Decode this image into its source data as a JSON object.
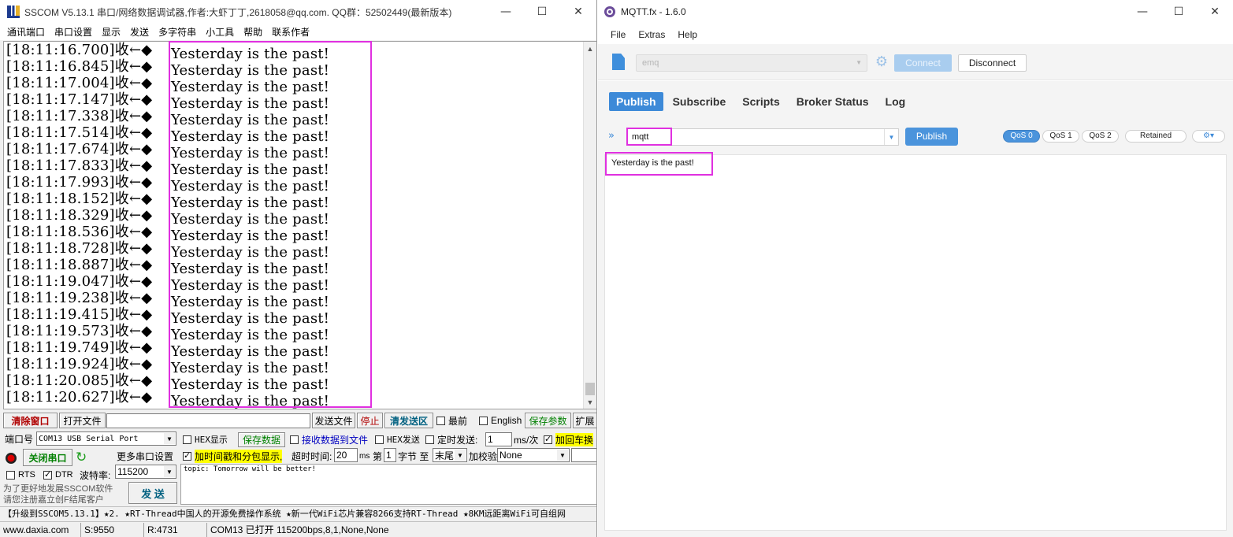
{
  "sscom": {
    "title": "SSCOM V5.13.1 串口/网络数据调试器,作者:大虾丁丁,2618058@qq.com. QQ群：52502449(最新版本)",
    "window_buttons": {
      "minimize": "—",
      "maximize": "☐",
      "close": "✕"
    },
    "menu": [
      "通讯端口",
      "串口设置",
      "显示",
      "发送",
      "多字符串",
      "小工具",
      "帮助",
      "联系作者"
    ],
    "receive_lines": [
      {
        "ts": "[18:11:16.700]收←◆",
        "msg": "Yesterday is the past!"
      },
      {
        "ts": "[18:11:16.845]收←◆",
        "msg": "Yesterday is the past!"
      },
      {
        "ts": "[18:11:17.004]收←◆",
        "msg": "Yesterday is the past!"
      },
      {
        "ts": "[18:11:17.147]收←◆",
        "msg": "Yesterday is the past!"
      },
      {
        "ts": "[18:11:17.338]收←◆",
        "msg": "Yesterday is the past!"
      },
      {
        "ts": "[18:11:17.514]收←◆",
        "msg": "Yesterday is the past!"
      },
      {
        "ts": "[18:11:17.674]收←◆",
        "msg": "Yesterday is the past!"
      },
      {
        "ts": "[18:11:17.833]收←◆",
        "msg": "Yesterday is the past!"
      },
      {
        "ts": "[18:11:17.993]收←◆",
        "msg": "Yesterday is the past!"
      },
      {
        "ts": "[18:11:18.152]收←◆",
        "msg": "Yesterday is the past!"
      },
      {
        "ts": "[18:11:18.329]收←◆",
        "msg": "Yesterday is the past!"
      },
      {
        "ts": "[18:11:18.536]收←◆",
        "msg": "Yesterday is the past!"
      },
      {
        "ts": "[18:11:18.728]收←◆",
        "msg": "Yesterday is the past!"
      },
      {
        "ts": "[18:11:18.887]收←◆",
        "msg": "Yesterday is the past!"
      },
      {
        "ts": "[18:11:19.047]收←◆",
        "msg": "Yesterday is the past!"
      },
      {
        "ts": "[18:11:19.238]收←◆",
        "msg": "Yesterday is the past!"
      },
      {
        "ts": "[18:11:19.415]收←◆",
        "msg": "Yesterday is the past!"
      },
      {
        "ts": "[18:11:19.573]收←◆",
        "msg": "Yesterday is the past!"
      },
      {
        "ts": "[18:11:19.749]收←◆",
        "msg": "Yesterday is the past!"
      },
      {
        "ts": "[18:11:19.924]收←◆",
        "msg": "Yesterday is the past!"
      },
      {
        "ts": "[18:11:20.085]收←◆",
        "msg": "Yesterday is the past!"
      },
      {
        "ts": "[18:11:20.627]收←◆",
        "msg": "Yesterday is the past!"
      }
    ],
    "row1": {
      "clear_window": "清除窗口",
      "open_file": "打开文件",
      "file_path": "",
      "send_file": "发送文件",
      "stop": "停止",
      "clear_send": "清发送区",
      "topmost": "最前",
      "english": "English",
      "save_params": "保存参数",
      "expand": "扩展"
    },
    "row2": {
      "port_label": "端口号",
      "port_value": "COM13 USB Serial Port",
      "hex_display": "HEX显示",
      "save_data": "保存数据",
      "recv_to_file": "接收数据到文件",
      "hex_send": "HEX发送",
      "timed_send": "定时发送:",
      "timed_value": "1",
      "timed_unit": "ms/次",
      "add_crlf": "加回车换"
    },
    "row3": {
      "close_port": "关闭串口",
      "more_settings": "更多串口设置",
      "timestamp": "加时间戳和分包显示,",
      "timeout_label": "超时时间:",
      "timeout_value": "20",
      "timeout_unit": "ms",
      "byte_prefix": "第",
      "byte_value": "1",
      "byte_suffix": "字节 至",
      "tail_value": "末尾",
      "checksum_label": "加校验",
      "checksum_value": "None"
    },
    "row4": {
      "rts": "RTS",
      "dtr": "DTR",
      "baud_label": "波特率:",
      "baud_value": "115200"
    },
    "send_text": "topic:  Tomorrow will be better!",
    "sponsor_line1": "为了更好地发展SSCOM软件",
    "sponsor_line2": "请您注册嘉立创F结尾客户",
    "send_button": "发  送",
    "promo": "【升级到SSCOM5.13.1】★2. ★RT-Thread中国人的开源免费操作系统 ★新一代WiFi芯片兼容8266支持RT-Thread ★8KM远距离WiFi可自组网",
    "status": {
      "website": "www.daxia.com",
      "sent": "S:9550",
      "received": "R:4731",
      "port_state": "COM13 已打开  115200bps,8,1,None,None"
    }
  },
  "mqtt": {
    "title": "MQTT.fx - 1.6.0",
    "window_buttons": {
      "minimize": "—",
      "maximize": "☐",
      "close": "✕"
    },
    "menu": [
      "File",
      "Extras",
      "Help"
    ],
    "profile": "emq",
    "connect": "Connect",
    "disconnect": "Disconnect",
    "tabs": [
      "Publish",
      "Subscribe",
      "Scripts",
      "Broker Status",
      "Log"
    ],
    "active_tab": "Publish",
    "topic": "mqtt",
    "publish_button": "Publish",
    "qos": [
      "QoS 0",
      "QoS 1",
      "QoS 2"
    ],
    "active_qos": "QoS 0",
    "retained": "Retained",
    "payload": "Yesterday is the past!"
  },
  "colors": {
    "highlight": "#e030e0",
    "mqtt_accent": "#3d8ad8"
  }
}
